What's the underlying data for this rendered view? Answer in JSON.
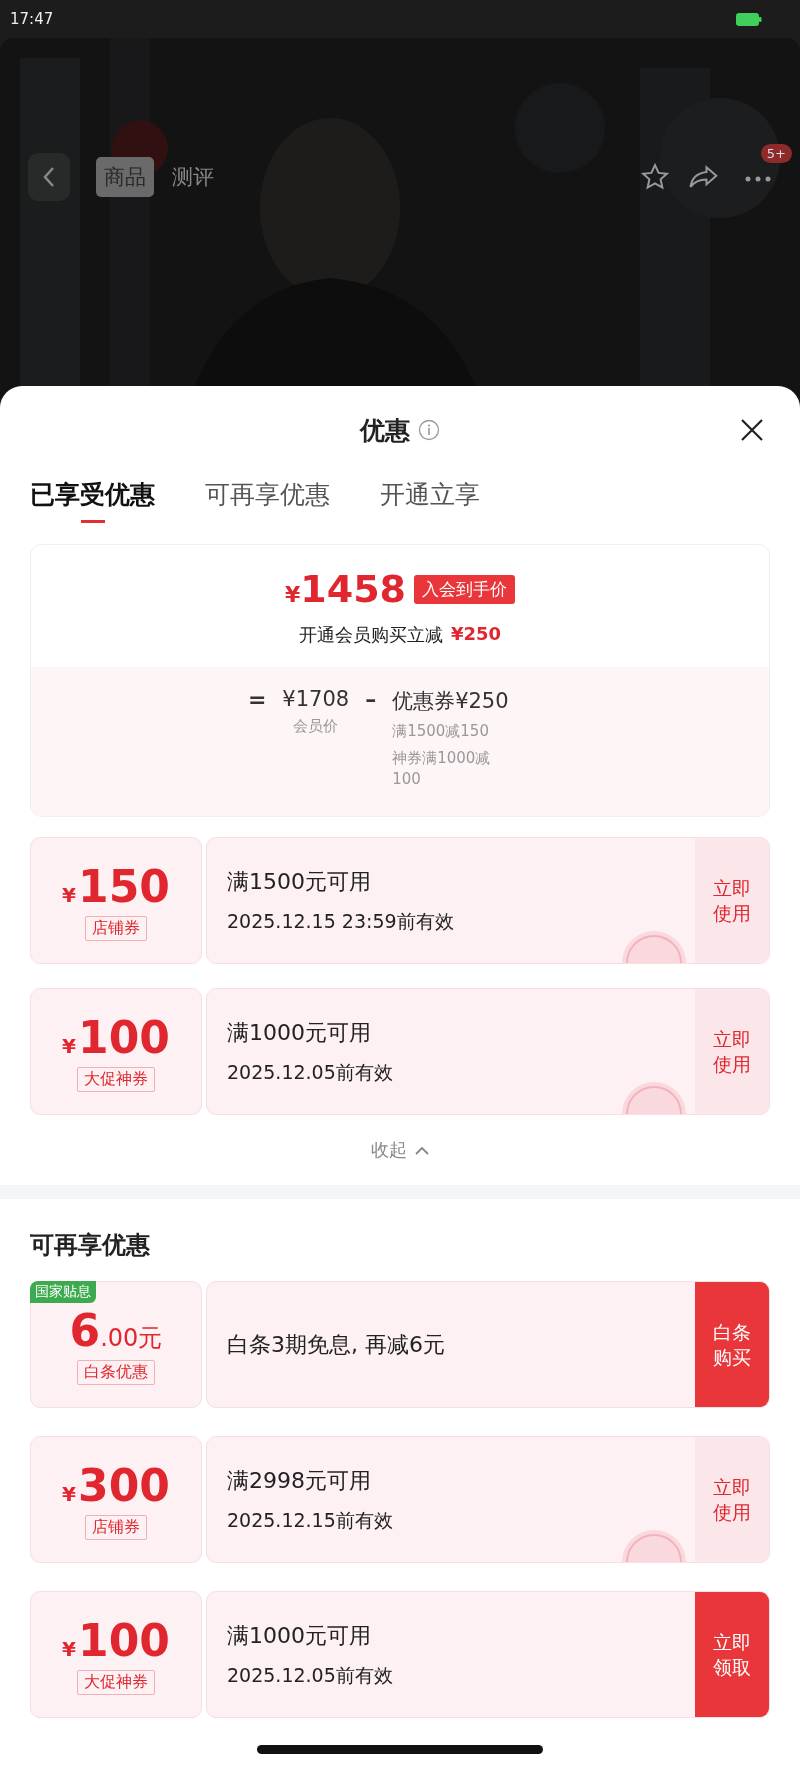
{
  "status_bar": {
    "time": "17:47"
  },
  "nav": {
    "tabs": [
      {
        "label": "商品",
        "selected": true
      },
      {
        "label": "测评",
        "selected": false
      }
    ],
    "badge": "5+"
  },
  "sheet": {
    "title": "优惠",
    "tabs": [
      {
        "label": "已享受优惠",
        "selected": true
      },
      {
        "label": "可再享优惠",
        "selected": false
      },
      {
        "label": "开通立享",
        "selected": false
      }
    ],
    "summary": {
      "currency": "¥",
      "price": "1458",
      "price_tag": "入会到手价",
      "note": "开通会员购买立减",
      "note_amount": "¥250",
      "eq": "=",
      "member_price": "¥1708",
      "member_label": "会员价",
      "minus": "–",
      "coupon_total": "优惠券¥250",
      "details": [
        "满1500减150",
        "神券满1000减100"
      ]
    },
    "applied": [
      {
        "kind": "coupon",
        "currency": "¥",
        "amount": "150",
        "tag": "店铺券",
        "condition": "满1500元可用",
        "expiry": "2025.12.15 23:59前有效",
        "action": "立即使用",
        "action_filled": false,
        "claimed": true
      },
      {
        "kind": "coupon",
        "currency": "¥",
        "amount": "100",
        "tag": "大促神券",
        "condition": "满1000元可用",
        "expiry": "2025.12.05前有效",
        "action": "立即使用",
        "action_filled": false,
        "claimed": true
      }
    ],
    "collapse": "收起",
    "more_title": "可再享优惠",
    "more": [
      {
        "kind": "subsidy",
        "ribbon": "国家贴息",
        "amount": "6",
        "decimals": ".00元",
        "tag": "白条优惠",
        "condition": "白条3期免息, 再减6元",
        "action": "白条购买",
        "action_filled": true,
        "claimed": false
      },
      {
        "kind": "coupon",
        "currency": "¥",
        "amount": "300",
        "tag": "店铺券",
        "condition": "满2998元可用",
        "expiry": "2025.12.15前有效",
        "action": "立即使用",
        "action_filled": false,
        "claimed": true
      },
      {
        "kind": "coupon",
        "currency": "¥",
        "amount": "100",
        "tag": "大促神券",
        "condition": "满1000元可用",
        "expiry": "2025.12.05前有效",
        "action": "立即领取",
        "action_filled": true,
        "claimed": false
      }
    ]
  }
}
